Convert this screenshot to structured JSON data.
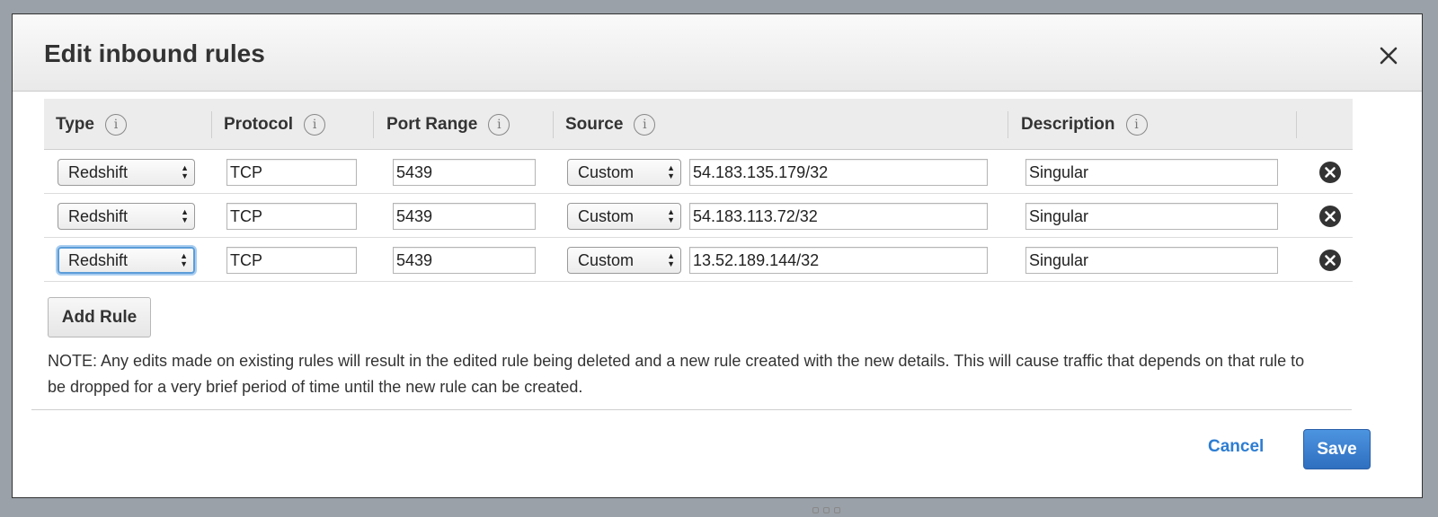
{
  "modal": {
    "title": "Edit inbound rules",
    "close_icon": "close-x-icon"
  },
  "table": {
    "headers": {
      "type": "Type",
      "protocol": "Protocol",
      "port_range": "Port Range",
      "source": "Source",
      "description": "Description"
    },
    "info_glyph": "i",
    "rows": [
      {
        "type": "Redshift",
        "protocol": "TCP",
        "port_range": "5439",
        "source_type": "Custom",
        "source": "54.183.135.179/32",
        "description": "Singular"
      },
      {
        "type": "Redshift",
        "protocol": "TCP",
        "port_range": "5439",
        "source_type": "Custom",
        "source": "54.183.113.72/32",
        "description": "Singular"
      },
      {
        "type": "Redshift",
        "protocol": "TCP",
        "port_range": "5439",
        "source_type": "Custom",
        "source": "13.52.189.144/32",
        "description": "Singular"
      }
    ]
  },
  "add_rule_label": "Add Rule",
  "note": "NOTE: Any edits made on existing rules will result in the edited rule being deleted and a new rule created with the new details. This will cause traffic that depends on that rule to be dropped for a very brief period of time until the new rule can be created.",
  "footer": {
    "cancel_label": "Cancel",
    "save_label": "Save"
  },
  "colors": {
    "primary_button": "#2f6fc0",
    "link": "#2d7dd2",
    "focus": "#5b9dd9"
  }
}
